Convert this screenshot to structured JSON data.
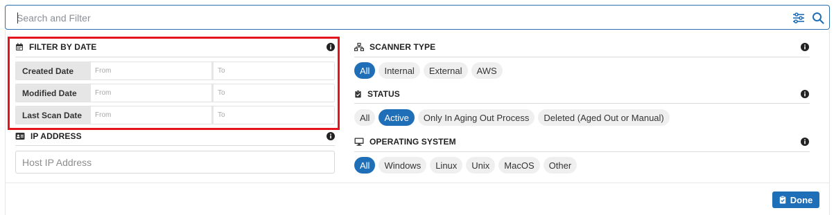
{
  "search": {
    "placeholder": "Search and Filter"
  },
  "filter_by_date": {
    "title": "FILTER BY DATE",
    "rows": [
      {
        "label": "Created Date",
        "from": "From",
        "to": "To"
      },
      {
        "label": "Modified Date",
        "from": "From",
        "to": "To"
      },
      {
        "label": "Last Scan Date",
        "from": "From",
        "to": "To"
      }
    ]
  },
  "ip_address": {
    "title": "IP ADDRESS",
    "placeholder": "Host IP Address"
  },
  "scanner_type": {
    "title": "SCANNER TYPE",
    "options": [
      "All",
      "Internal",
      "External",
      "AWS"
    ],
    "selected": "All"
  },
  "status": {
    "title": "STATUS",
    "options": [
      "All",
      "Active",
      "Only In Aging Out Process",
      "Deleted (Aged Out or Manual)"
    ],
    "selected": "Active"
  },
  "operating_system": {
    "title": "OPERATING SYSTEM",
    "options": [
      "All",
      "Windows",
      "Linux",
      "Unix",
      "MacOS",
      "Other"
    ],
    "selected": "All"
  },
  "done_button": {
    "label": "Done"
  },
  "icons": {
    "filter": "sliders-icon",
    "search": "search-icon",
    "date": "calendar-icon",
    "ip": "id-card-icon",
    "scanner": "network-icon",
    "status": "clipboard-check-icon",
    "os": "desktop-icon",
    "info": "info-icon",
    "done": "clipboard-check-icon"
  },
  "colors": {
    "accent": "#1f6fb8",
    "highlight": "#e3141b",
    "border": "#2a6fb0"
  }
}
